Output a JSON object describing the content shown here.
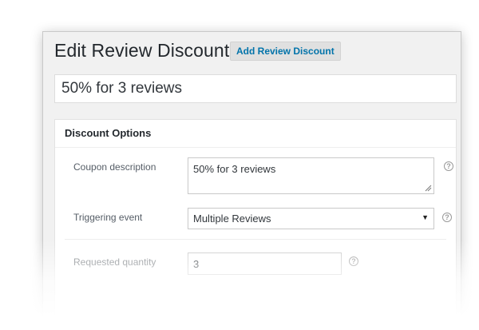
{
  "page": {
    "title": "Edit Review Discount",
    "add_button_label": "Add Review Discount",
    "post_title_value": "50% for 3 reviews"
  },
  "discount_options": {
    "header": "Discount Options",
    "coupon_description": {
      "label": "Coupon description",
      "value": "50% for 3 reviews"
    },
    "triggering_event": {
      "label": "Triggering event",
      "selected": "Multiple Reviews"
    },
    "requested_quantity": {
      "label": "Requested quantity",
      "value": "3"
    },
    "help_glyph": "?"
  },
  "colors": {
    "link_blue": "#0073aa",
    "admin_bg": "#f1f1f1",
    "text_dark": "#23282d"
  }
}
